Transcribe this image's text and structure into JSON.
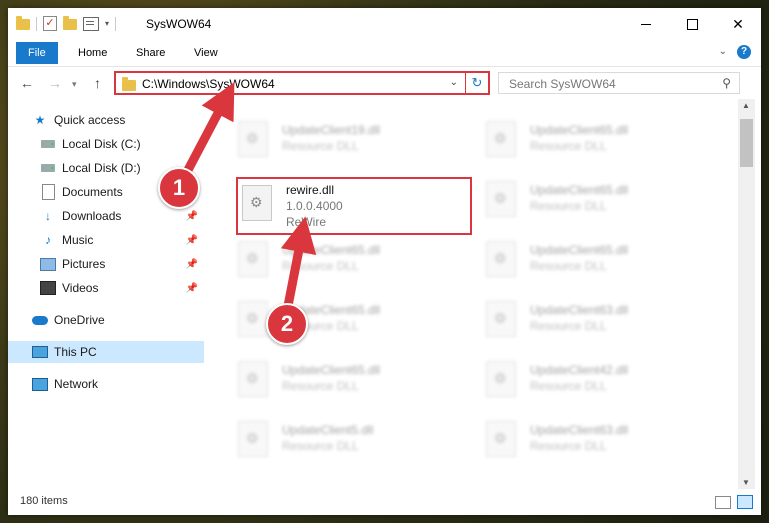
{
  "window": {
    "title": "SysWOW64"
  },
  "ribbon": {
    "tabs": [
      "File",
      "Home",
      "Share",
      "View"
    ],
    "help": "?"
  },
  "address": {
    "path": "C:\\Windows\\SysWOW64",
    "refresh_glyph": "↻"
  },
  "search": {
    "placeholder": "Search SysWOW64"
  },
  "sidebar": {
    "items": [
      {
        "label": "Quick access",
        "icon": "star-icon"
      },
      {
        "label": "Local Disk (C:)",
        "icon": "disk-icon"
      },
      {
        "label": "Local Disk (D:)",
        "icon": "disk-icon"
      },
      {
        "label": "Documents",
        "icon": "document-icon"
      },
      {
        "label": "Downloads",
        "icon": "download-icon"
      },
      {
        "label": "Music",
        "icon": "music-icon"
      },
      {
        "label": "Pictures",
        "icon": "pictures-icon"
      },
      {
        "label": "Videos",
        "icon": "video-icon"
      },
      {
        "label": "OneDrive",
        "icon": "cloud-icon"
      },
      {
        "label": "This PC",
        "icon": "computer-icon",
        "selected": true
      },
      {
        "label": "Network",
        "icon": "network-icon"
      }
    ]
  },
  "files": {
    "highlighted": {
      "name": "rewire.dll",
      "version": "1.0.0.4000",
      "company": "ReWire"
    },
    "left_column": [
      {
        "name": "UpdateClient19.dll",
        "type": "Resource DLL"
      },
      {
        "name": "UpdateClient65.dll",
        "type": "Resource DLL"
      },
      {
        "name": "UpdateClient65.dll",
        "type": "Resource DLL"
      },
      {
        "name": "UpdateClient65.dll",
        "type": "Resource DLL"
      },
      {
        "name": "UpdateClient5.dll",
        "type": "Resource DLL"
      }
    ],
    "right_column": [
      {
        "name": "UpdateClient65.dll",
        "type": "Resource DLL"
      },
      {
        "name": "UpdateClient65.dll",
        "type": "Resource DLL"
      },
      {
        "name": "UpdateClient65.dll",
        "type": "Resource DLL"
      },
      {
        "name": "UpdateClient63.dll",
        "type": "Resource DLL"
      },
      {
        "name": "UpdateClient42.dll",
        "type": "Resource DLL"
      },
      {
        "name": "UpdateClient63.dll",
        "type": "Resource DLL"
      }
    ]
  },
  "status": {
    "count": "180 items"
  },
  "annotations": {
    "step1": "1",
    "step2": "2",
    "color": "#d9363e"
  }
}
